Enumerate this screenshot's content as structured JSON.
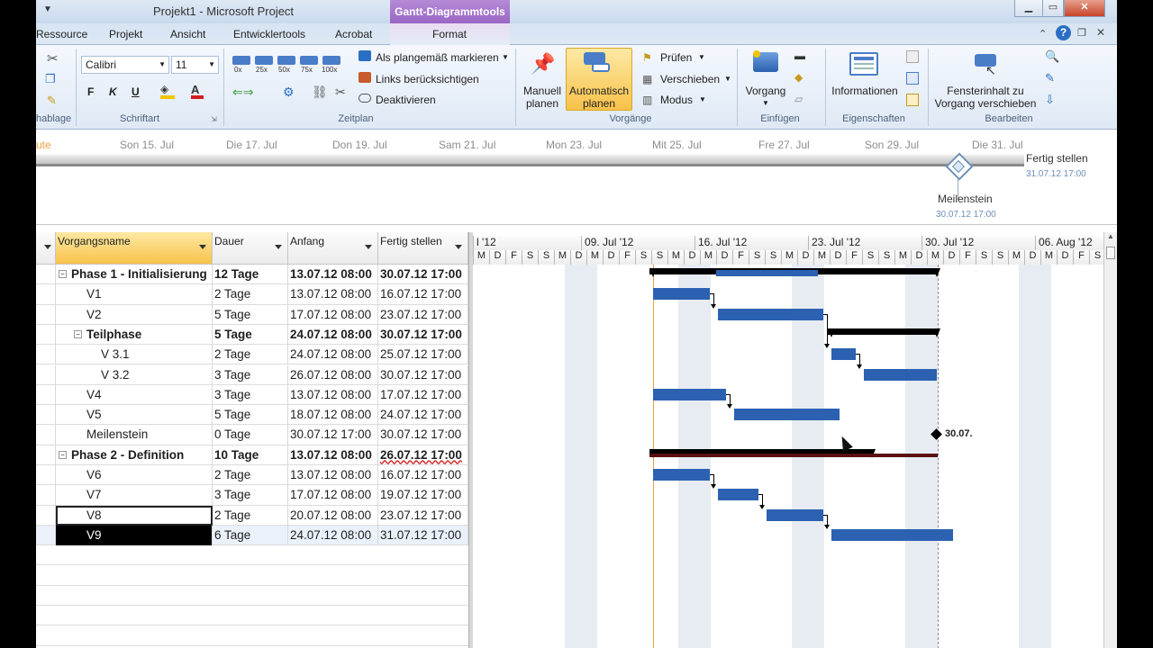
{
  "window": {
    "title": "Projekt1  -  Microsoft Project",
    "context_tab": "Gantt-Diagrammtools",
    "buttons": {
      "min": "▁",
      "max": "▭",
      "close": "✕"
    }
  },
  "tabs": [
    {
      "label": "Ressource"
    },
    {
      "label": "Projekt"
    },
    {
      "label": "Ansicht"
    },
    {
      "label": "Entwicklertools"
    },
    {
      "label": "Acrobat"
    },
    {
      "label": "Format"
    }
  ],
  "ribbon": {
    "groups": [
      "hablage",
      "Schriftart",
      "Zeitplan",
      "Vorgänge",
      "Einfügen",
      "Eigenschaften",
      "Bearbeiten"
    ],
    "font": {
      "name": "Calibri",
      "size": "11"
    },
    "zeitplan": {
      "mark_on_track": "Als plangemäß markieren",
      "respect_links": "Links berücksichtigen",
      "deactivate": "Deaktivieren",
      "pct": [
        "0x",
        "25x",
        "50x",
        "75x",
        "100x"
      ]
    },
    "vorgaenge": {
      "manual": [
        "Manuell",
        "planen"
      ],
      "auto": [
        "Automatisch",
        "planen"
      ],
      "check": "Prüfen",
      "move": "Verschieben",
      "mode": "Modus"
    },
    "einfuegen": {
      "task": "Vorgang"
    },
    "eigenschaften": {
      "info": "Informationen"
    },
    "bearbeiten": {
      "scroll": [
        "Fensterinhalt zu",
        "Vorgang verschieben"
      ]
    }
  },
  "timeline": {
    "dates": [
      "ute",
      "Son 15. Jul",
      "Die 17. Jul",
      "Don 19. Jul",
      "Sam 21. Jul",
      "Mon 23. Jul",
      "Mit 25. Jul",
      "Fre 27. Jul",
      "Son 29. Jul",
      "Die 31. Jul"
    ],
    "finish_label": "Fertig stellen",
    "finish_date": "31.07.12 17:00",
    "milestone_label": "Meilenstein",
    "milestone_date": "30.07.12 17:00"
  },
  "table": {
    "headers": {
      "name": "Vorgangsname",
      "duration": "Dauer",
      "start": "Anfang",
      "finish": "Fertig stellen"
    },
    "rows": [
      {
        "name": "Phase 1 - Initialisierung",
        "duration": "12 Tage",
        "start": "13.07.12 08:00",
        "finish": "30.07.12 17:00",
        "level": 0,
        "summary": true,
        "collapse": "−"
      },
      {
        "name": "V1",
        "duration": "2 Tage",
        "start": "13.07.12 08:00",
        "finish": "16.07.12 17:00",
        "level": 1,
        "summary": false
      },
      {
        "name": "V2",
        "duration": "5 Tage",
        "start": "17.07.12 08:00",
        "finish": "23.07.12 17:00",
        "level": 1,
        "summary": false
      },
      {
        "name": "Teilphase",
        "duration": "5 Tage",
        "start": "24.07.12 08:00",
        "finish": "30.07.12 17:00",
        "level": 1,
        "summary": true,
        "collapse": "−"
      },
      {
        "name": "V 3.1",
        "duration": "2 Tage",
        "start": "24.07.12 08:00",
        "finish": "25.07.12 17:00",
        "level": 2,
        "summary": false
      },
      {
        "name": "V 3.2",
        "duration": "3 Tage",
        "start": "26.07.12 08:00",
        "finish": "30.07.12 17:00",
        "level": 2,
        "summary": false
      },
      {
        "name": "V4",
        "duration": "3 Tage",
        "start": "13.07.12 08:00",
        "finish": "17.07.12 17:00",
        "level": 1,
        "summary": false
      },
      {
        "name": "V5",
        "duration": "5 Tage",
        "start": "18.07.12 08:00",
        "finish": "24.07.12 17:00",
        "level": 1,
        "summary": false
      },
      {
        "name": "Meilenstein",
        "duration": "0 Tage",
        "start": "30.07.12 17:00",
        "finish": "30.07.12 17:00",
        "level": 1,
        "summary": false
      },
      {
        "name": "Phase 2 - Definition",
        "duration": "10 Tage",
        "start": "13.07.12 08:00",
        "finish": "26.07.12 17:00",
        "level": 0,
        "summary": true,
        "collapse": "−"
      },
      {
        "name": "V6",
        "duration": "2 Tage",
        "start": "13.07.12 08:00",
        "finish": "16.07.12 17:00",
        "level": 1,
        "summary": false
      },
      {
        "name": "V7",
        "duration": "3 Tage",
        "start": "17.07.12 08:00",
        "finish": "19.07.12 17:00",
        "level": 1,
        "summary": false
      },
      {
        "name": "V8",
        "duration": "2 Tage",
        "start": "20.07.12 08:00",
        "finish": "23.07.12 17:00",
        "level": 1,
        "summary": false
      },
      {
        "name": "V9",
        "duration": "6 Tage",
        "start": "24.07.12 08:00",
        "finish": "31.07.12 17:00",
        "level": 1,
        "summary": false
      }
    ]
  },
  "gantt": {
    "weeks": [
      "l '12",
      "09. Jul '12",
      "16. Jul '12",
      "23. Jul '12",
      "30. Jul '12",
      "06. Aug '12"
    ],
    "days": [
      "M",
      "D",
      "F",
      "S",
      "S",
      "M",
      "D",
      "M",
      "D",
      "F",
      "S",
      "S",
      "M",
      "D",
      "M",
      "D",
      "F",
      "S",
      "S",
      "M",
      "D",
      "M",
      "D",
      "F",
      "S",
      "S",
      "M",
      "D",
      "M",
      "D",
      "F",
      "S",
      "S",
      "M",
      "D",
      "M",
      "D",
      "F",
      "S",
      "S",
      "M",
      "D",
      "M",
      "D",
      "F",
      "S",
      "S",
      "M",
      "D",
      "M",
      "D",
      "F",
      "S",
      "S",
      "M",
      "D"
    ],
    "milestone_label": "30.07.",
    "colors": {
      "task": "#2b61b0",
      "summary": "#000000",
      "today": "#f0a040"
    }
  }
}
